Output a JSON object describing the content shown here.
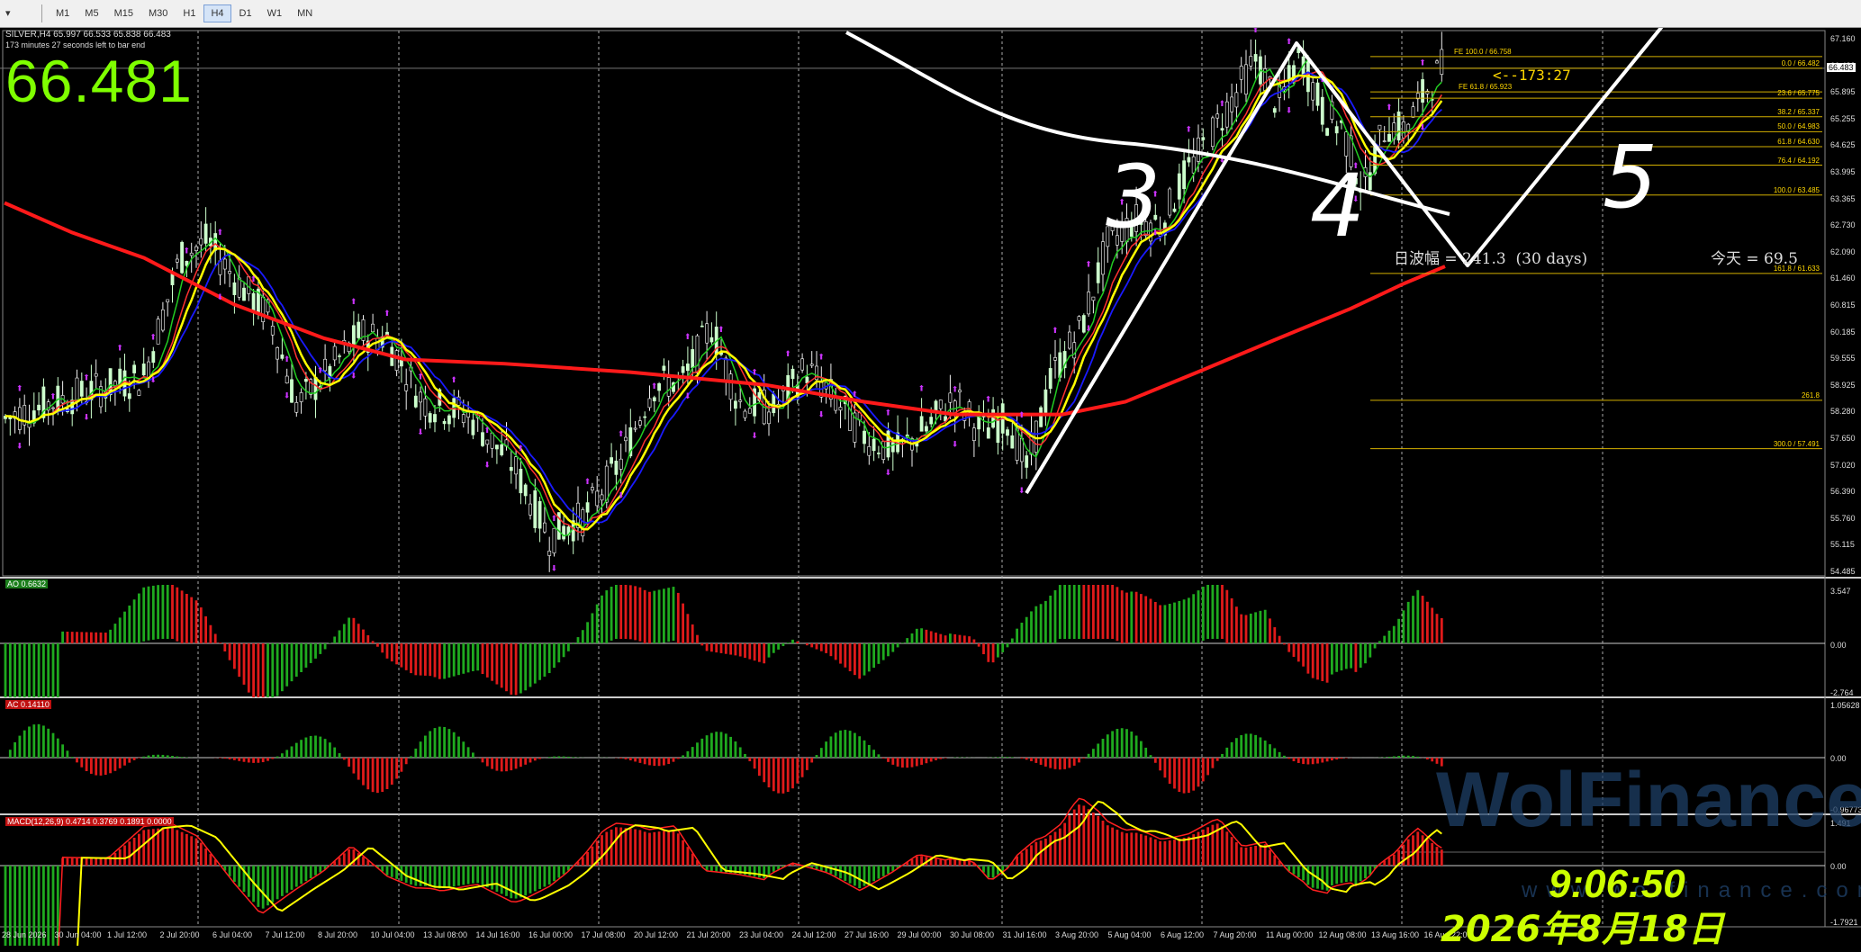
{
  "toolbar": {
    "dropdown_label": "▾",
    "timeframes": [
      "M1",
      "M5",
      "M15",
      "M30",
      "H1",
      "H4",
      "D1",
      "W1",
      "MN"
    ],
    "active_timeframe": "H4"
  },
  "chart": {
    "symbol_line": "SILVER,H4  65.997 66.533 65.838 66.483",
    "bar_timer_text": "173 minutes 27 seconds left to bar end",
    "big_price": "66.481",
    "countdown": "<--173:27",
    "day_range": "日波幅 = 241.3  (30 days)",
    "today": "今天 = 69.5",
    "wave_labels": [
      "3",
      "4",
      "5"
    ],
    "price_axis": [
      "67.160",
      "66.483",
      "65.895",
      "65.255",
      "64.625",
      "63.995",
      "63.365",
      "62.730",
      "62.090",
      "61.460",
      "60.815",
      "60.185",
      "59.555",
      "58.925",
      "58.280",
      "57.650",
      "57.020",
      "56.390",
      "55.760",
      "55.115",
      "54.485"
    ],
    "current_price_tag": "66.483",
    "time_axis": [
      "28 Jun 2026",
      "30 Jun 04:00",
      "1 Jul 12:00",
      "2 Jul 20:00",
      "6 Jul 04:00",
      "7 Jul 12:00",
      "8 Jul 20:00",
      "10 Jul 04:00",
      "13 Jul 08:00",
      "14 Jul 16:00",
      "16 Jul 00:00",
      "17 Jul 08:00",
      "20 Jul 12:00",
      "21 Jul 20:00",
      "23 Jul 04:00",
      "24 Jul 12:00",
      "27 Jul 16:00",
      "29 Jul 00:00",
      "30 Jul 08:00",
      "31 Jul 16:00",
      "3 Aug 20:00",
      "5 Aug 04:00",
      "6 Aug 12:00",
      "7 Aug 20:00",
      "11 Aug 00:00",
      "12 Aug 08:00",
      "13 Aug 16:00",
      "16 Aug 22:00"
    ],
    "fib_levels": [
      {
        "label": "FE 100.0  /  66.758",
        "price": 66.758
      },
      {
        "label": "0.0  /  66.482",
        "price": 66.482
      },
      {
        "label": "FE 61.8  /  65.923",
        "price": 65.923
      },
      {
        "label": "23.6  /  65.775",
        "price": 65.775
      },
      {
        "label": "38.2  /  65.337",
        "price": 65.337
      },
      {
        "label": "50.0  /  64.983",
        "price": 64.983
      },
      {
        "label": "61.8  /  64.630",
        "price": 64.63
      },
      {
        "label": "76.4  /  64.192",
        "price": 64.192
      },
      {
        "label": "100.0  /  63.485",
        "price": 63.485
      },
      {
        "label": "161.8  /  61.633",
        "price": 61.633
      },
      {
        "label": "261.8",
        "price": 58.636
      },
      {
        "label": "300.0  /  57.491",
        "price": 57.491
      }
    ],
    "colors": {
      "ma_slow": "#ff1a1a",
      "ma_blue": "#1a1aff",
      "ma_yellow": "#ffff00",
      "ma_green": "#22cc22",
      "ma_red_fast": "#ff3030",
      "bull": "#ccffcc",
      "fib": "#d4b000",
      "marker": "#cc33ff"
    }
  },
  "ao": {
    "label": "AO 0.6632",
    "axis": [
      "3.547",
      "0.00",
      "-2.764"
    ]
  },
  "ac": {
    "label": "AC 0.14110",
    "axis": [
      "1.05628",
      "0.00",
      "-0.96773"
    ]
  },
  "macd": {
    "label": "MACD(12,26,9) 0.4714 0.3769 0.1891 0.0000",
    "axis": [
      "1.491",
      "0.00",
      "-1.7921"
    ]
  },
  "overlay": {
    "clock": "9:06:50",
    "date": "2026年8月18日",
    "watermark": "WolFinance",
    "watermark_url": "www.wolfinance.com"
  }
}
